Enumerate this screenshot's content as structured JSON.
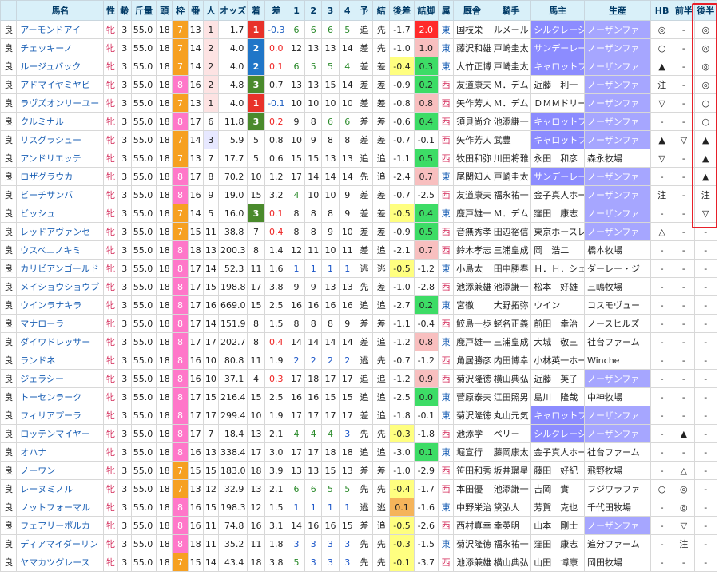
{
  "headers": [
    "馬名",
    "性",
    "齢",
    "斤量",
    "頭",
    "枠",
    "番",
    "人",
    "オッズ",
    "着",
    "差",
    "1",
    "2",
    "3",
    "4",
    "予",
    "結",
    "後差",
    "詰脚",
    "属",
    "厩舎",
    "騎手",
    "馬主",
    "生産",
    "HB",
    "前半",
    "後半"
  ],
  "rows": [
    {
      "track": "良",
      "name": "アーモンドアイ",
      "sex": "牝",
      "age": "3",
      "weight": "55.0",
      "heads": "18",
      "waku": "7",
      "ban": "13",
      "pop": "1",
      "odds": "1.7",
      "rank": "1",
      "margin": "-0.3",
      "p1": "6",
      "p2": "6",
      "p3": "6",
      "p4": "5",
      "pred": "追",
      "res": "先",
      "kosa": "-1.7",
      "tsume": "2.0",
      "aff": "東",
      "trainer": "国枝栄",
      "jockey": "ルメール",
      "owner": "シルクレーシ",
      "breeder": "ノーザンファ",
      "hb": "◎",
      "zen": "-",
      "kou": "◎"
    },
    {
      "track": "良",
      "name": "チェッキーノ",
      "sex": "牝",
      "age": "3",
      "weight": "55.0",
      "heads": "18",
      "waku": "7",
      "ban": "14",
      "pop": "2",
      "odds": "4.0",
      "rank": "2",
      "margin": "0.0",
      "p1": "12",
      "p2": "13",
      "p3": "13",
      "p4": "14",
      "pred": "差",
      "res": "先",
      "kosa": "-1.0",
      "tsume": "1.0",
      "aff": "東",
      "trainer": "藤沢和雄",
      "jockey": "戸崎圭太",
      "owner": "サンデーレー",
      "breeder": "ノーザンファ",
      "hb": "○",
      "zen": "-",
      "kou": "◎"
    },
    {
      "track": "良",
      "name": "ルージュバック",
      "sex": "牝",
      "age": "3",
      "weight": "55.0",
      "heads": "18",
      "waku": "7",
      "ban": "14",
      "pop": "2",
      "odds": "4.0",
      "rank": "2",
      "margin": "0.1",
      "p1": "6",
      "p2": "5",
      "p3": "5",
      "p4": "4",
      "pred": "差",
      "res": "差",
      "kosa": "-0.4",
      "tsume": "0.3",
      "aff": "東",
      "trainer": "大竹正博",
      "jockey": "戸崎圭太",
      "owner": "キャロットフ",
      "breeder": "ノーザンファ",
      "hb": "▲",
      "zen": "-",
      "kou": "◎"
    },
    {
      "track": "良",
      "name": "アドマイヤミヤビ",
      "sex": "牝",
      "age": "3",
      "weight": "55.0",
      "heads": "18",
      "waku": "8",
      "ban": "16",
      "pop": "2",
      "odds": "4.8",
      "rank": "3",
      "margin": "0.7",
      "p1": "13",
      "p2": "13",
      "p3": "15",
      "p4": "14",
      "pred": "差",
      "res": "差",
      "kosa": "-0.9",
      "tsume": "0.2",
      "aff": "西",
      "trainer": "友道康夫",
      "jockey": "Ｍ．デム",
      "owner": "近藤　利一",
      "breeder": "ノーザンファ",
      "hb": "注",
      "zen": "-",
      "kou": "◎"
    },
    {
      "track": "良",
      "name": "ラヴズオンリーユー",
      "sex": "牝",
      "age": "3",
      "weight": "55.0",
      "heads": "18",
      "waku": "7",
      "ban": "13",
      "pop": "1",
      "odds": "4.0",
      "rank": "1",
      "margin": "-0.1",
      "p1": "10",
      "p2": "10",
      "p3": "10",
      "p4": "10",
      "pred": "差",
      "res": "差",
      "kosa": "-0.8",
      "tsume": "0.8",
      "aff": "西",
      "trainer": "矢作芳人",
      "jockey": "Ｍ．デム",
      "owner": "ＤＭＭドリー",
      "breeder": "ノーザンファ",
      "hb": "▽",
      "zen": "-",
      "kou": "○"
    },
    {
      "track": "良",
      "name": "クルミナル",
      "sex": "牝",
      "age": "3",
      "weight": "55.0",
      "heads": "18",
      "waku": "8",
      "ban": "17",
      "pop": "6",
      "odds": "11.8",
      "rank": "3",
      "margin": "0.2",
      "p1": "9",
      "p2": "8",
      "p3": "6",
      "p4": "6",
      "pred": "差",
      "res": "差",
      "kosa": "-0.6",
      "tsume": "0.4",
      "aff": "西",
      "trainer": "須貝尚介",
      "jockey": "池添謙一",
      "owner": "キャロットフ",
      "breeder": "ノーザンファ",
      "hb": "-",
      "zen": "-",
      "kou": "○"
    },
    {
      "track": "良",
      "name": "リスグラシュー",
      "sex": "牝",
      "age": "3",
      "weight": "55.0",
      "heads": "18",
      "waku": "7",
      "ban": "14",
      "pop": "3",
      "odds": "5.9",
      "rank": "5",
      "margin": "0.8",
      "p1": "10",
      "p2": "9",
      "p3": "8",
      "p4": "8",
      "pred": "差",
      "res": "差",
      "kosa": "-0.7",
      "tsume": "-0.1",
      "aff": "西",
      "trainer": "矢作芳人",
      "jockey": "武豊",
      "owner": "キャロットフ",
      "breeder": "ノーザンファ",
      "hb": "▲",
      "zen": "▽",
      "kou": "▲"
    },
    {
      "track": "良",
      "name": "アンドリエッテ",
      "sex": "牝",
      "age": "3",
      "weight": "55.0",
      "heads": "18",
      "waku": "7",
      "ban": "13",
      "pop": "7",
      "odds": "17.7",
      "rank": "5",
      "margin": "0.6",
      "p1": "15",
      "p2": "15",
      "p3": "13",
      "p4": "13",
      "pred": "追",
      "res": "追",
      "kosa": "-1.1",
      "tsume": "0.5",
      "aff": "西",
      "trainer": "牧田和弥",
      "jockey": "川田将雅",
      "owner": "永田　和彦",
      "breeder": "森永牧場",
      "hb": "▽",
      "zen": "-",
      "kou": "▲"
    },
    {
      "track": "良",
      "name": "ロザグラウカ",
      "sex": "牝",
      "age": "3",
      "weight": "55.0",
      "heads": "18",
      "waku": "8",
      "ban": "17",
      "pop": "8",
      "odds": "70.2",
      "rank": "10",
      "margin": "1.2",
      "p1": "17",
      "p2": "14",
      "p3": "14",
      "p4": "14",
      "pred": "先",
      "res": "追",
      "kosa": "-2.4",
      "tsume": "0.7",
      "aff": "東",
      "trainer": "尾関知人",
      "jockey": "戸崎圭太",
      "owner": "サンデーレー",
      "breeder": "ノーザンファ",
      "hb": "-",
      "zen": "-",
      "kou": "▲"
    },
    {
      "track": "良",
      "name": "ビーチサンバ",
      "sex": "牝",
      "age": "3",
      "weight": "55.0",
      "heads": "18",
      "waku": "8",
      "ban": "16",
      "pop": "9",
      "odds": "19.0",
      "rank": "15",
      "margin": "3.2",
      "p1": "4",
      "p2": "10",
      "p3": "10",
      "p4": "9",
      "pred": "差",
      "res": "差",
      "kosa": "-0.7",
      "tsume": "-2.5",
      "aff": "西",
      "trainer": "友道康夫",
      "jockey": "福永祐一",
      "owner": "金子真人ホー",
      "breeder": "ノーザンファ",
      "hb": "注",
      "zen": "-",
      "kou": "注"
    },
    {
      "track": "良",
      "name": "ビッシュ",
      "sex": "牝",
      "age": "3",
      "weight": "55.0",
      "heads": "18",
      "waku": "7",
      "ban": "14",
      "pop": "5",
      "odds": "16.0",
      "rank": "3",
      "margin": "0.1",
      "p1": "8",
      "p2": "8",
      "p3": "8",
      "p4": "9",
      "pred": "差",
      "res": "差",
      "kosa": "-0.5",
      "tsume": "0.4",
      "aff": "東",
      "trainer": "鹿戸雄一",
      "jockey": "Ｍ．デム",
      "owner": "窪田　康志",
      "breeder": "ノーザンファ",
      "hb": "-",
      "zen": "-",
      "kou": "▽"
    },
    {
      "track": "良",
      "name": "レッドアヴァンセ",
      "sex": "牝",
      "age": "3",
      "weight": "55.0",
      "heads": "18",
      "waku": "7",
      "ban": "15",
      "pop": "11",
      "odds": "38.8",
      "rank": "7",
      "margin": "0.4",
      "p1": "8",
      "p2": "8",
      "p3": "9",
      "p4": "10",
      "pred": "差",
      "res": "差",
      "kosa": "-0.9",
      "tsume": "0.5",
      "aff": "西",
      "trainer": "音無秀孝",
      "jockey": "田辺裕信",
      "owner": "東京ホースレ",
      "breeder": "ノーザンファ",
      "hb": "△",
      "zen": "-",
      "kou": "-"
    },
    {
      "track": "良",
      "name": "ウスベニノキミ",
      "sex": "牝",
      "age": "3",
      "weight": "55.0",
      "heads": "18",
      "waku": "8",
      "ban": "18",
      "pop": "13",
      "odds": "200.3",
      "rank": "8",
      "margin": "1.4",
      "p1": "12",
      "p2": "11",
      "p3": "10",
      "p4": "11",
      "pred": "差",
      "res": "追",
      "kosa": "-2.1",
      "tsume": "0.7",
      "aff": "西",
      "trainer": "鈴木孝志",
      "jockey": "三浦皇成",
      "owner": "岡　浩二",
      "breeder": "橋本牧場",
      "hb": "-",
      "zen": "-",
      "kou": "-"
    },
    {
      "track": "良",
      "name": "カリビアンゴールド",
      "sex": "牝",
      "age": "3",
      "weight": "55.0",
      "heads": "18",
      "waku": "8",
      "ban": "17",
      "pop": "14",
      "odds": "52.3",
      "rank": "11",
      "margin": "1.6",
      "p1": "1",
      "p2": "1",
      "p3": "1",
      "p4": "1",
      "pred": "逃",
      "res": "逃",
      "kosa": "-0.5",
      "tsume": "-1.2",
      "aff": "東",
      "trainer": "小島太",
      "jockey": "田中勝春",
      "owner": "Ｈ．Ｈ．シェ",
      "breeder": "ダーレー・ジ",
      "hb": "-",
      "zen": "-",
      "kou": "-"
    },
    {
      "track": "良",
      "name": "メイショウショウブ",
      "sex": "牝",
      "age": "3",
      "weight": "55.0",
      "heads": "18",
      "waku": "8",
      "ban": "17",
      "pop": "15",
      "odds": "198.8",
      "rank": "17",
      "margin": "3.8",
      "p1": "9",
      "p2": "9",
      "p3": "13",
      "p4": "13",
      "pred": "先",
      "res": "差",
      "kosa": "-1.0",
      "tsume": "-2.8",
      "aff": "西",
      "trainer": "池添兼雄",
      "jockey": "池添謙一",
      "owner": "松本　好雄",
      "breeder": "三嶋牧場",
      "hb": "-",
      "zen": "-",
      "kou": "-"
    },
    {
      "track": "良",
      "name": "ウインラナキラ",
      "sex": "牝",
      "age": "3",
      "weight": "55.0",
      "heads": "18",
      "waku": "8",
      "ban": "17",
      "pop": "16",
      "odds": "669.0",
      "rank": "15",
      "margin": "2.5",
      "p1": "16",
      "p2": "16",
      "p3": "16",
      "p4": "16",
      "pred": "追",
      "res": "追",
      "kosa": "-2.7",
      "tsume": "0.2",
      "aff": "東",
      "trainer": "宮徹",
      "jockey": "大野拓弥",
      "owner": "ウイン",
      "breeder": "コスモヴュー",
      "hb": "-",
      "zen": "-",
      "kou": "-"
    },
    {
      "track": "良",
      "name": "マナローラ",
      "sex": "牝",
      "age": "3",
      "weight": "55.0",
      "heads": "18",
      "waku": "8",
      "ban": "17",
      "pop": "14",
      "odds": "151.9",
      "rank": "8",
      "margin": "1.5",
      "p1": "8",
      "p2": "8",
      "p3": "8",
      "p4": "9",
      "pred": "差",
      "res": "差",
      "kosa": "-1.1",
      "tsume": "-0.4",
      "aff": "西",
      "trainer": "鮫島一歩",
      "jockey": "蛯名正義",
      "owner": "前田　幸治",
      "breeder": "ノースヒルズ",
      "hb": "-",
      "zen": "-",
      "kou": "-"
    },
    {
      "track": "良",
      "name": "ダイワドレッサー",
      "sex": "牝",
      "age": "3",
      "weight": "55.0",
      "heads": "18",
      "waku": "8",
      "ban": "17",
      "pop": "17",
      "odds": "202.7",
      "rank": "8",
      "margin": "0.4",
      "p1": "14",
      "p2": "14",
      "p3": "14",
      "p4": "14",
      "pred": "差",
      "res": "追",
      "kosa": "-1.2",
      "tsume": "0.8",
      "aff": "東",
      "trainer": "鹿戸雄一",
      "jockey": "三浦皇成",
      "owner": "大城　敬三",
      "breeder": "社台ファーム",
      "hb": "-",
      "zen": "-",
      "kou": "-"
    },
    {
      "track": "良",
      "name": "ランドネ",
      "sex": "牝",
      "age": "3",
      "weight": "55.0",
      "heads": "18",
      "waku": "8",
      "ban": "16",
      "pop": "10",
      "odds": "80.8",
      "rank": "11",
      "margin": "1.9",
      "p1": "2",
      "p2": "2",
      "p3": "2",
      "p4": "2",
      "pred": "逃",
      "res": "先",
      "kosa": "-0.7",
      "tsume": "-1.2",
      "aff": "西",
      "trainer": "角居勝彦",
      "jockey": "内田博幸",
      "owner": "小林英一ホー",
      "breeder": "Winche",
      "hb": "-",
      "zen": "-",
      "kou": "-"
    },
    {
      "track": "良",
      "name": "ジェラシー",
      "sex": "牝",
      "age": "3",
      "weight": "55.0",
      "heads": "18",
      "waku": "8",
      "ban": "16",
      "pop": "10",
      "odds": "37.1",
      "rank": "4",
      "margin": "0.3",
      "p1": "17",
      "p2": "18",
      "p3": "17",
      "p4": "17",
      "pred": "追",
      "res": "追",
      "kosa": "-1.2",
      "tsume": "0.9",
      "aff": "西",
      "trainer": "菊沢隆徳",
      "jockey": "横山典弘",
      "owner": "近藤　英子",
      "breeder": "ノーザンファ",
      "hb": "-",
      "zen": "-",
      "kou": "-"
    },
    {
      "track": "良",
      "name": "トーセンラーク",
      "sex": "牝",
      "age": "3",
      "weight": "55.0",
      "heads": "18",
      "waku": "8",
      "ban": "17",
      "pop": "15",
      "odds": "216.4",
      "rank": "15",
      "margin": "2.5",
      "p1": "16",
      "p2": "16",
      "p3": "15",
      "p4": "15",
      "pred": "追",
      "res": "追",
      "kosa": "-2.5",
      "tsume": "0.0",
      "aff": "東",
      "trainer": "菅原泰夫",
      "jockey": "江田照男",
      "owner": "島川　隆哉",
      "breeder": "中神牧場",
      "hb": "-",
      "zen": "-",
      "kou": "-"
    },
    {
      "track": "良",
      "name": "フィリアプーラ",
      "sex": "牝",
      "age": "3",
      "weight": "55.0",
      "heads": "18",
      "waku": "8",
      "ban": "17",
      "pop": "17",
      "odds": "299.4",
      "rank": "10",
      "margin": "1.9",
      "p1": "17",
      "p2": "17",
      "p3": "17",
      "p4": "17",
      "pred": "差",
      "res": "追",
      "kosa": "-1.8",
      "tsume": "-0.1",
      "aff": "東",
      "trainer": "菊沢隆徳",
      "jockey": "丸山元気",
      "owner": "キャロットフ",
      "breeder": "ノーザンファ",
      "hb": "-",
      "zen": "-",
      "kou": "-"
    },
    {
      "track": "良",
      "name": "ロッテンマイヤー",
      "sex": "牝",
      "age": "3",
      "weight": "55.0",
      "heads": "18",
      "waku": "8",
      "ban": "17",
      "pop": "7",
      "odds": "18.4",
      "rank": "13",
      "margin": "2.1",
      "p1": "4",
      "p2": "4",
      "p3": "4",
      "p4": "3",
      "pred": "先",
      "res": "先",
      "kosa": "-0.3",
      "tsume": "-1.8",
      "aff": "西",
      "trainer": "池添学",
      "jockey": "ベリー",
      "owner": "シルクレーシ",
      "breeder": "ノーザンファ",
      "hb": "-",
      "zen": "▲",
      "kou": "-"
    },
    {
      "track": "良",
      "name": "オハナ",
      "sex": "牝",
      "age": "3",
      "weight": "55.0",
      "heads": "18",
      "waku": "8",
      "ban": "16",
      "pop": "13",
      "odds": "338.4",
      "rank": "17",
      "margin": "3.0",
      "p1": "17",
      "p2": "17",
      "p3": "18",
      "p4": "18",
      "pred": "追",
      "res": "追",
      "kosa": "-3.0",
      "tsume": "0.1",
      "aff": "東",
      "trainer": "堀宣行",
      "jockey": "藤岡康太",
      "owner": "金子真人ホー",
      "breeder": "社台ファーム",
      "hb": "-",
      "zen": "-",
      "kou": "-"
    },
    {
      "track": "良",
      "name": "ノーワン",
      "sex": "牝",
      "age": "3",
      "weight": "55.0",
      "heads": "18",
      "waku": "7",
      "ban": "15",
      "pop": "15",
      "odds": "183.0",
      "rank": "18",
      "margin": "3.9",
      "p1": "13",
      "p2": "13",
      "p3": "15",
      "p4": "13",
      "pred": "差",
      "res": "差",
      "kosa": "-1.0",
      "tsume": "-2.9",
      "aff": "西",
      "trainer": "笹田和秀",
      "jockey": "坂井瑠星",
      "owner": "藤田　好紀",
      "breeder": "飛野牧場",
      "hb": "-",
      "zen": "△",
      "kou": "-"
    },
    {
      "track": "良",
      "name": "レーヌミノル",
      "sex": "牝",
      "age": "3",
      "weight": "55.0",
      "heads": "18",
      "waku": "7",
      "ban": "13",
      "pop": "12",
      "odds": "32.9",
      "rank": "13",
      "margin": "2.1",
      "p1": "6",
      "p2": "6",
      "p3": "5",
      "p4": "5",
      "pred": "先",
      "res": "先",
      "kosa": "-0.4",
      "tsume": "-1.7",
      "aff": "西",
      "trainer": "本田優",
      "jockey": "池添謙一",
      "owner": "吉岡　實",
      "breeder": "フジワラファ",
      "hb": "○",
      "zen": "◎",
      "kou": "-"
    },
    {
      "track": "良",
      "name": "ノットフォーマル",
      "sex": "牝",
      "age": "3",
      "weight": "55.0",
      "heads": "18",
      "waku": "8",
      "ban": "16",
      "pop": "15",
      "odds": "198.3",
      "rank": "12",
      "margin": "1.5",
      "p1": "1",
      "p2": "1",
      "p3": "1",
      "p4": "1",
      "pred": "逃",
      "res": "逃",
      "kosa": "0.1",
      "tsume": "-1.6",
      "aff": "東",
      "trainer": "中野栄治",
      "jockey": "黛弘人",
      "owner": "芳賀　克也",
      "breeder": "千代田牧場",
      "hb": "-",
      "zen": "◎",
      "kou": "-"
    },
    {
      "track": "良",
      "name": "フェアリーポルカ",
      "sex": "牝",
      "age": "3",
      "weight": "55.0",
      "heads": "18",
      "waku": "8",
      "ban": "16",
      "pop": "11",
      "odds": "74.8",
      "rank": "16",
      "margin": "3.1",
      "p1": "14",
      "p2": "16",
      "p3": "16",
      "p4": "15",
      "pred": "差",
      "res": "追",
      "kosa": "-0.5",
      "tsume": "-2.6",
      "aff": "西",
      "trainer": "西村真幸",
      "jockey": "幸英明",
      "owner": "山本　剛士",
      "breeder": "ノーザンファ",
      "hb": "-",
      "zen": "▽",
      "kou": "-"
    },
    {
      "track": "良",
      "name": "ディアマイダーリン",
      "sex": "牝",
      "age": "3",
      "weight": "55.0",
      "heads": "18",
      "waku": "8",
      "ban": "18",
      "pop": "11",
      "odds": "35.2",
      "rank": "11",
      "margin": "1.8",
      "p1": "3",
      "p2": "3",
      "p3": "3",
      "p4": "3",
      "pred": "先",
      "res": "先",
      "kosa": "-0.3",
      "tsume": "-1.5",
      "aff": "東",
      "trainer": "菊沢隆徳",
      "jockey": "福永祐一",
      "owner": "窪田　康志",
      "breeder": "追分ファーム",
      "hb": "-",
      "zen": "注",
      "kou": "-"
    },
    {
      "track": "良",
      "name": "ヤマカツグレース",
      "sex": "牝",
      "age": "3",
      "weight": "55.0",
      "heads": "18",
      "waku": "7",
      "ban": "15",
      "pop": "14",
      "odds": "43.4",
      "rank": "18",
      "margin": "3.8",
      "p1": "5",
      "p2": "3",
      "p3": "3",
      "p4": "3",
      "pred": "先",
      "res": "先",
      "kosa": "-0.1",
      "tsume": "-3.7",
      "aff": "西",
      "trainer": "池添兼雄",
      "jockey": "横山典弘",
      "owner": "山田　博康",
      "breeder": "岡田牧場",
      "hb": "-",
      "zen": "-",
      "kou": "-"
    }
  ],
  "colors": {
    "header_bg": "#d9f0f9",
    "waku7": "#f6a021",
    "waku8": "#ff77c9",
    "rank1": "#e8322a",
    "rank2": "#2076c8",
    "rank3": "#4a8a2c",
    "highlight_border": "#e8202a"
  }
}
